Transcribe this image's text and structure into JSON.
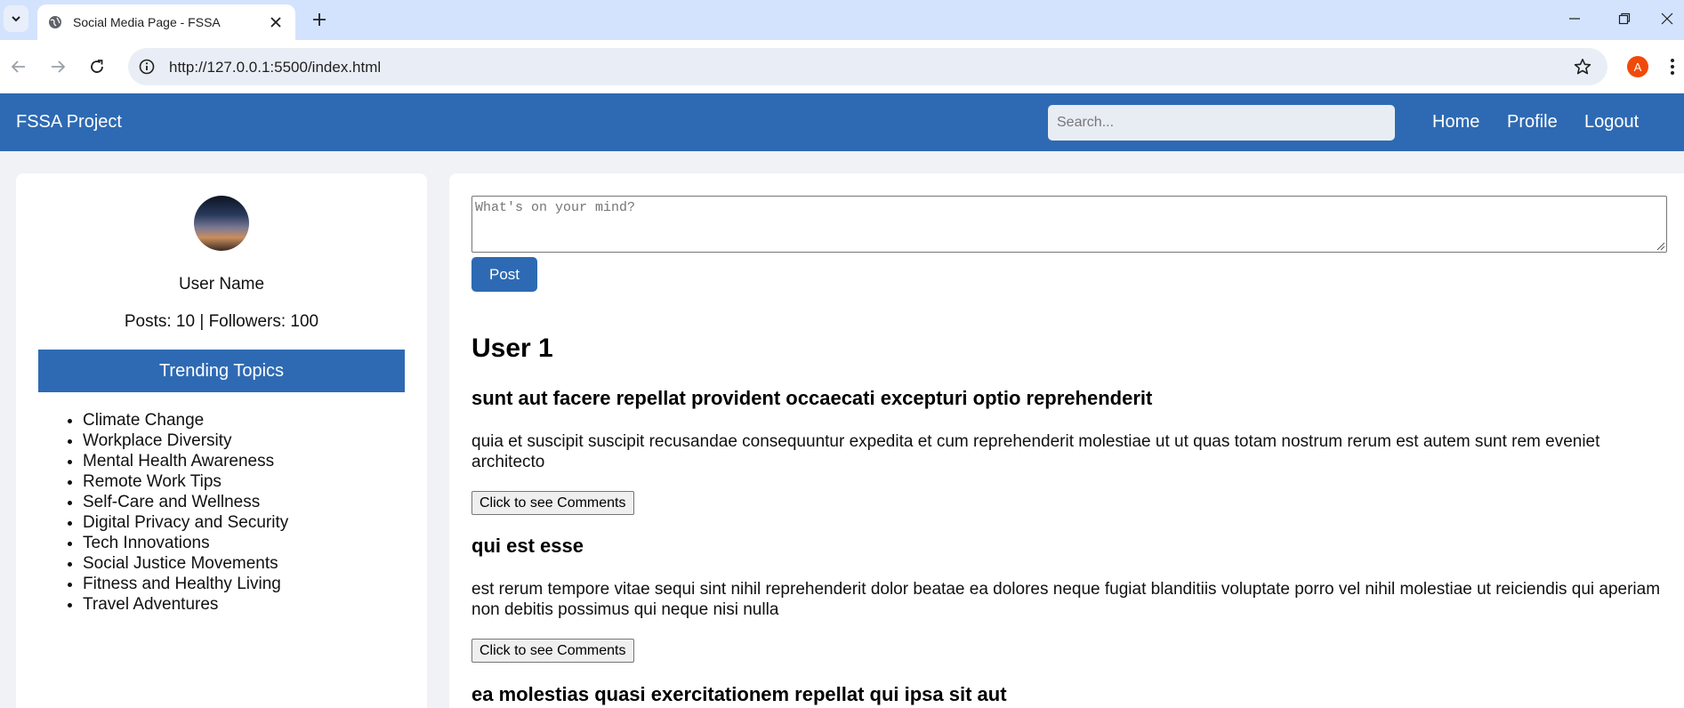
{
  "browser": {
    "tab_title": "Social Media Page - FSSA",
    "url": "http://127.0.0.1:5500/index.html",
    "profile_initial": "A"
  },
  "nav": {
    "brand": "FSSA Project",
    "search_placeholder": "Search...",
    "links": [
      "Home",
      "Profile",
      "Logout"
    ]
  },
  "profile": {
    "name": "User Name",
    "stats": "Posts: 10 | Followers: 100"
  },
  "trending": {
    "title": "Trending Topics",
    "topics": [
      "Climate Change",
      "Workplace Diversity",
      "Mental Health Awareness",
      "Remote Work Tips",
      "Self-Care and Wellness",
      "Digital Privacy and Security",
      "Tech Innovations",
      "Social Justice Movements",
      "Fitness and Healthy Living",
      "Travel Adventures"
    ]
  },
  "composer": {
    "placeholder": "What's on your mind?",
    "post_label": "Post"
  },
  "feed": {
    "user": "User 1",
    "comments_label": "Click to see Comments",
    "posts": [
      {
        "title": "sunt aut facere repellat provident occaecati excepturi optio reprehenderit",
        "body": "quia et suscipit suscipit recusandae consequuntur expedita et cum reprehenderit molestiae ut ut quas totam nostrum rerum est autem sunt rem eveniet architecto"
      },
      {
        "title": "qui est esse",
        "body": "est rerum tempore vitae sequi sint nihil reprehenderit dolor beatae ea dolores neque fugiat blanditiis voluptate porro vel nihil molestiae ut reiciendis qui aperiam non debitis possimus qui neque nisi nulla"
      },
      {
        "title": "ea molestias quasi exercitationem repellat qui ipsa sit aut"
      }
    ]
  },
  "colors": {
    "brand_blue": "#2e6ab3",
    "page_bg": "#f0f2f5",
    "tabstrip_bg": "#d3e3fd"
  }
}
